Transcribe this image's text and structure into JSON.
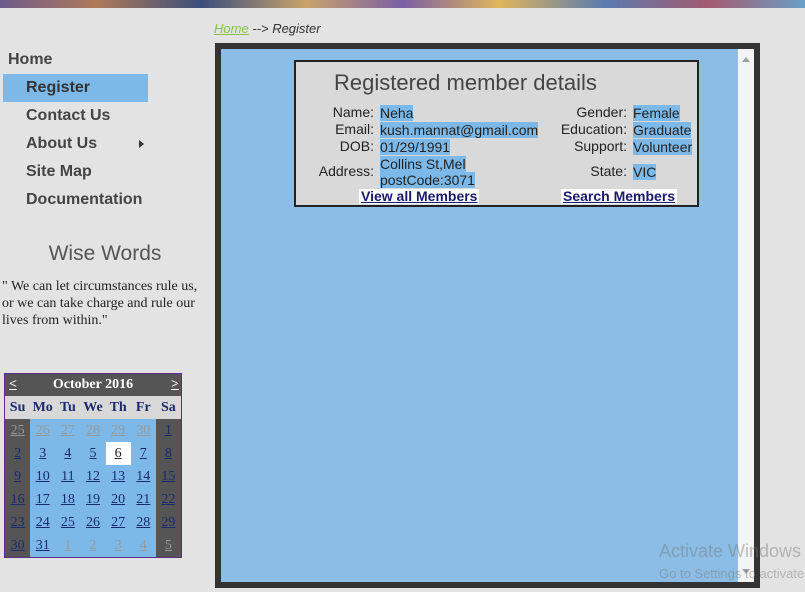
{
  "breadcrumb": {
    "home": "Home",
    "separator": "-->",
    "current": "Register"
  },
  "nav": {
    "items": [
      {
        "label": "Home"
      },
      {
        "label": "Register"
      },
      {
        "label": "Contact Us"
      },
      {
        "label": "About Us"
      },
      {
        "label": "Site Map"
      },
      {
        "label": "Documentation"
      }
    ],
    "submenu_arrow_icon": "triangle-right-icon"
  },
  "wise_words": {
    "title": "Wise Words",
    "quote": "\" We can let circumstances rule us, or we can take charge and rule our lives from within.\""
  },
  "calendar": {
    "month_label": "October 2016",
    "prev": "<",
    "next": ">",
    "weekdays": [
      "Su",
      "Mo",
      "Tu",
      "We",
      "Th",
      "Fr",
      "Sa"
    ],
    "days": [
      "25",
      "26",
      "27",
      "28",
      "29",
      "30",
      "1",
      "2",
      "3",
      "4",
      "5",
      "6",
      "7",
      "8",
      "9",
      "10",
      "11",
      "12",
      "13",
      "14",
      "15",
      "16",
      "17",
      "18",
      "19",
      "20",
      "21",
      "22",
      "23",
      "24",
      "25",
      "26",
      "27",
      "28",
      "29",
      "30",
      "31",
      "1",
      "2",
      "3",
      "4",
      "5"
    ],
    "today": "6"
  },
  "details": {
    "title": "Registered member details",
    "name_label": "Name:",
    "name_value": "Neha",
    "email_label": "Email:",
    "email_value": "kush.mannat@gmail.com",
    "dob_label": "DOB:",
    "dob_value": "01/29/1991",
    "address_label": "Address:",
    "address_line1": "Collins St,Mel",
    "address_line2": "postCode:3071",
    "gender_label": "Gender:",
    "gender_value": "Female",
    "education_label": "Education:",
    "education_value": "Graduate",
    "support_label": "Support:",
    "support_value": "Volunteer",
    "state_label": "State:",
    "state_value": "VIC",
    "view_all_link": "View all Members",
    "search_link": "Search Members"
  },
  "watermark": {
    "title": "Activate Windows",
    "subtitle": "Go to Settings to activate Windows."
  },
  "colors": {
    "accent": "#7db9e8",
    "panel_bg": "#8bbde6",
    "calendar_header": "#555555",
    "link_green": "#8bc34a"
  }
}
